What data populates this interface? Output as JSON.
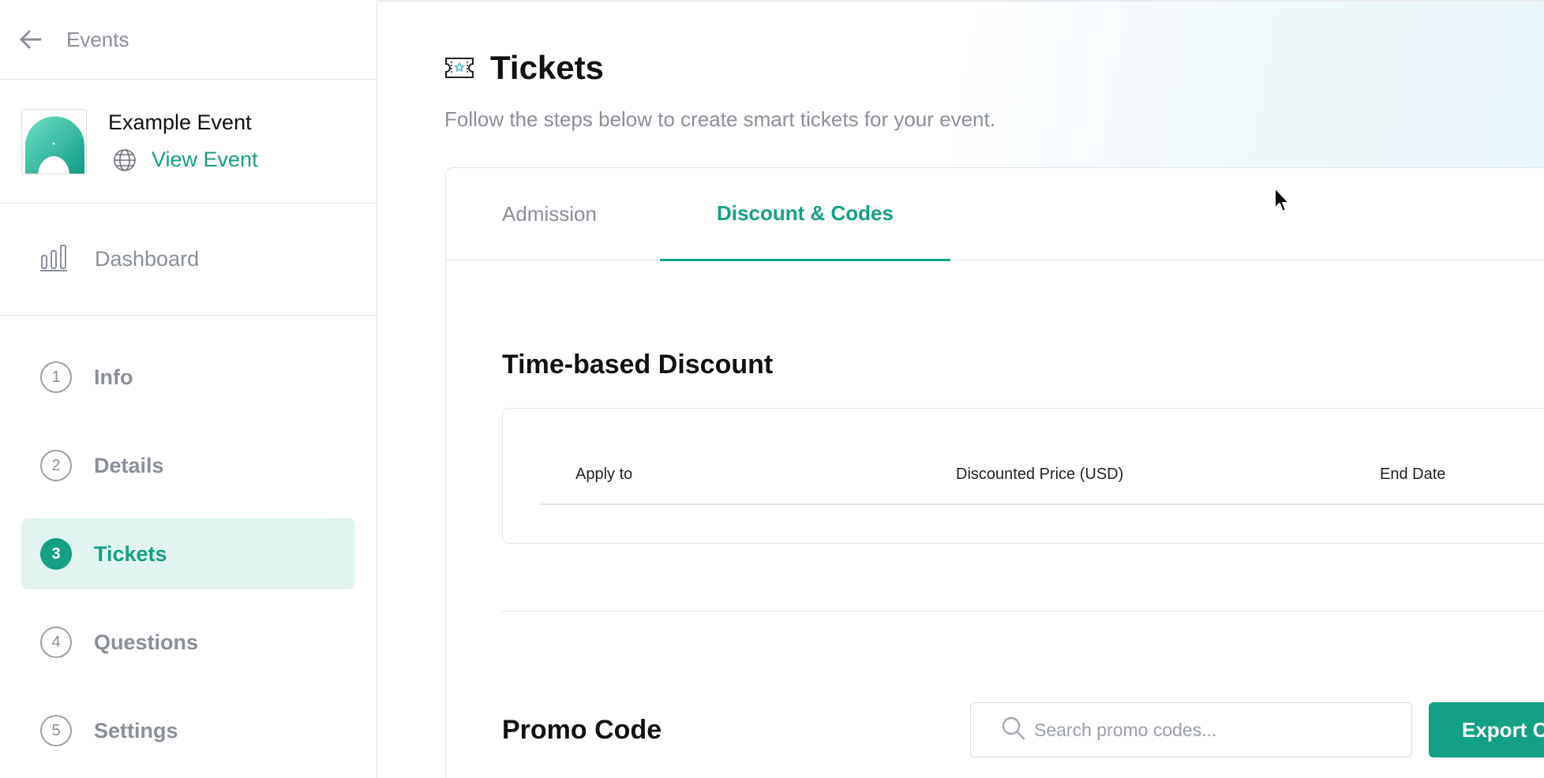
{
  "sidebar": {
    "back_label": "Events",
    "event_name": "Example Event",
    "view_event_label": "View Event",
    "dashboard_label": "Dashboard",
    "steps": [
      {
        "num": "1",
        "label": "Info"
      },
      {
        "num": "2",
        "label": "Details"
      },
      {
        "num": "3",
        "label": "Tickets"
      },
      {
        "num": "4",
        "label": "Questions"
      },
      {
        "num": "5",
        "label": "Settings"
      }
    ],
    "active_step": "Tickets"
  },
  "header": {
    "title": "Tickets",
    "subtitle": "Follow the steps below to create smart tickets for your event."
  },
  "tabs": {
    "admission": "Admission",
    "discount": "Discount & Codes",
    "active": "Discount & Codes"
  },
  "time_discount": {
    "title": "Time-based Discount",
    "columns": [
      "Apply to",
      "Discounted Price (USD)",
      "End Date"
    ]
  },
  "promo": {
    "title": "Promo Code",
    "search_placeholder": "Search promo codes...",
    "export_label": "Export C"
  },
  "colors": {
    "accent": "#14a085",
    "active_bg": "#e2f4f0",
    "muted_text": "#8a8f98"
  },
  "icons": [
    "back-arrow-icon",
    "globe-icon",
    "bar-chart-icon",
    "ticket-icon",
    "search-icon",
    "mouse-cursor-icon"
  ]
}
